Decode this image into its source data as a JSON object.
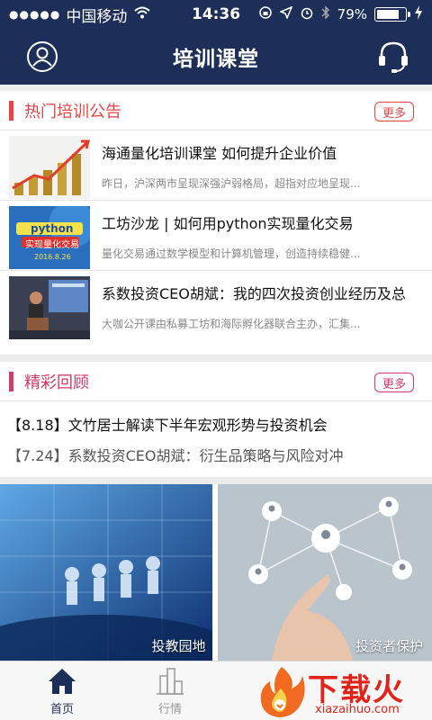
{
  "status": {
    "carrier": "中国移动",
    "time": "14:36",
    "battery": "79%",
    "battery_level": 0.79
  },
  "header": {
    "title": "培训课堂"
  },
  "announcements": {
    "title": "热门培训公告",
    "more": "更多",
    "items": [
      {
        "title": "海通量化培训课堂  如何提升企业价值",
        "desc": "昨日，沪深两市呈现深强沪弱格局，超指对应地呈现..."
      },
      {
        "title": "工坊沙龙 | 如何用python实现量化交易",
        "desc": "量化交易通过数学模型和计算机管理，创造持续稳健...",
        "thumb_text": "python",
        "thumb_sub": "实现量化交易",
        "thumb_date": "2016.8.26"
      },
      {
        "title": "系数投资CEO胡斌：我的四次投资创业经历及总",
        "desc": "大咖公开课由私募工坊和海际孵化器联合主办，汇集..."
      }
    ]
  },
  "reviews": {
    "title": "精彩回顾",
    "more": "更多",
    "items": [
      {
        "text": "【8.18】文竹居士解读下半年宏观形势与投资机会"
      },
      {
        "text": "【7.24】系数投资CEO胡斌：衍生品策略与风险对冲"
      }
    ]
  },
  "banners": [
    {
      "caption": "投教园地"
    },
    {
      "caption": "投资者保护"
    }
  ],
  "tabs": [
    {
      "label": "首页",
      "active": true
    },
    {
      "label": "行情",
      "active": false
    }
  ],
  "watermark": {
    "brand": "下载火",
    "site": "xiazaihuo.com"
  },
  "colors": {
    "navbar": "#1d2f58",
    "accent_red": "#e64545",
    "accent_pink": "#d33a6a",
    "tab_active": "#1d2f58"
  }
}
